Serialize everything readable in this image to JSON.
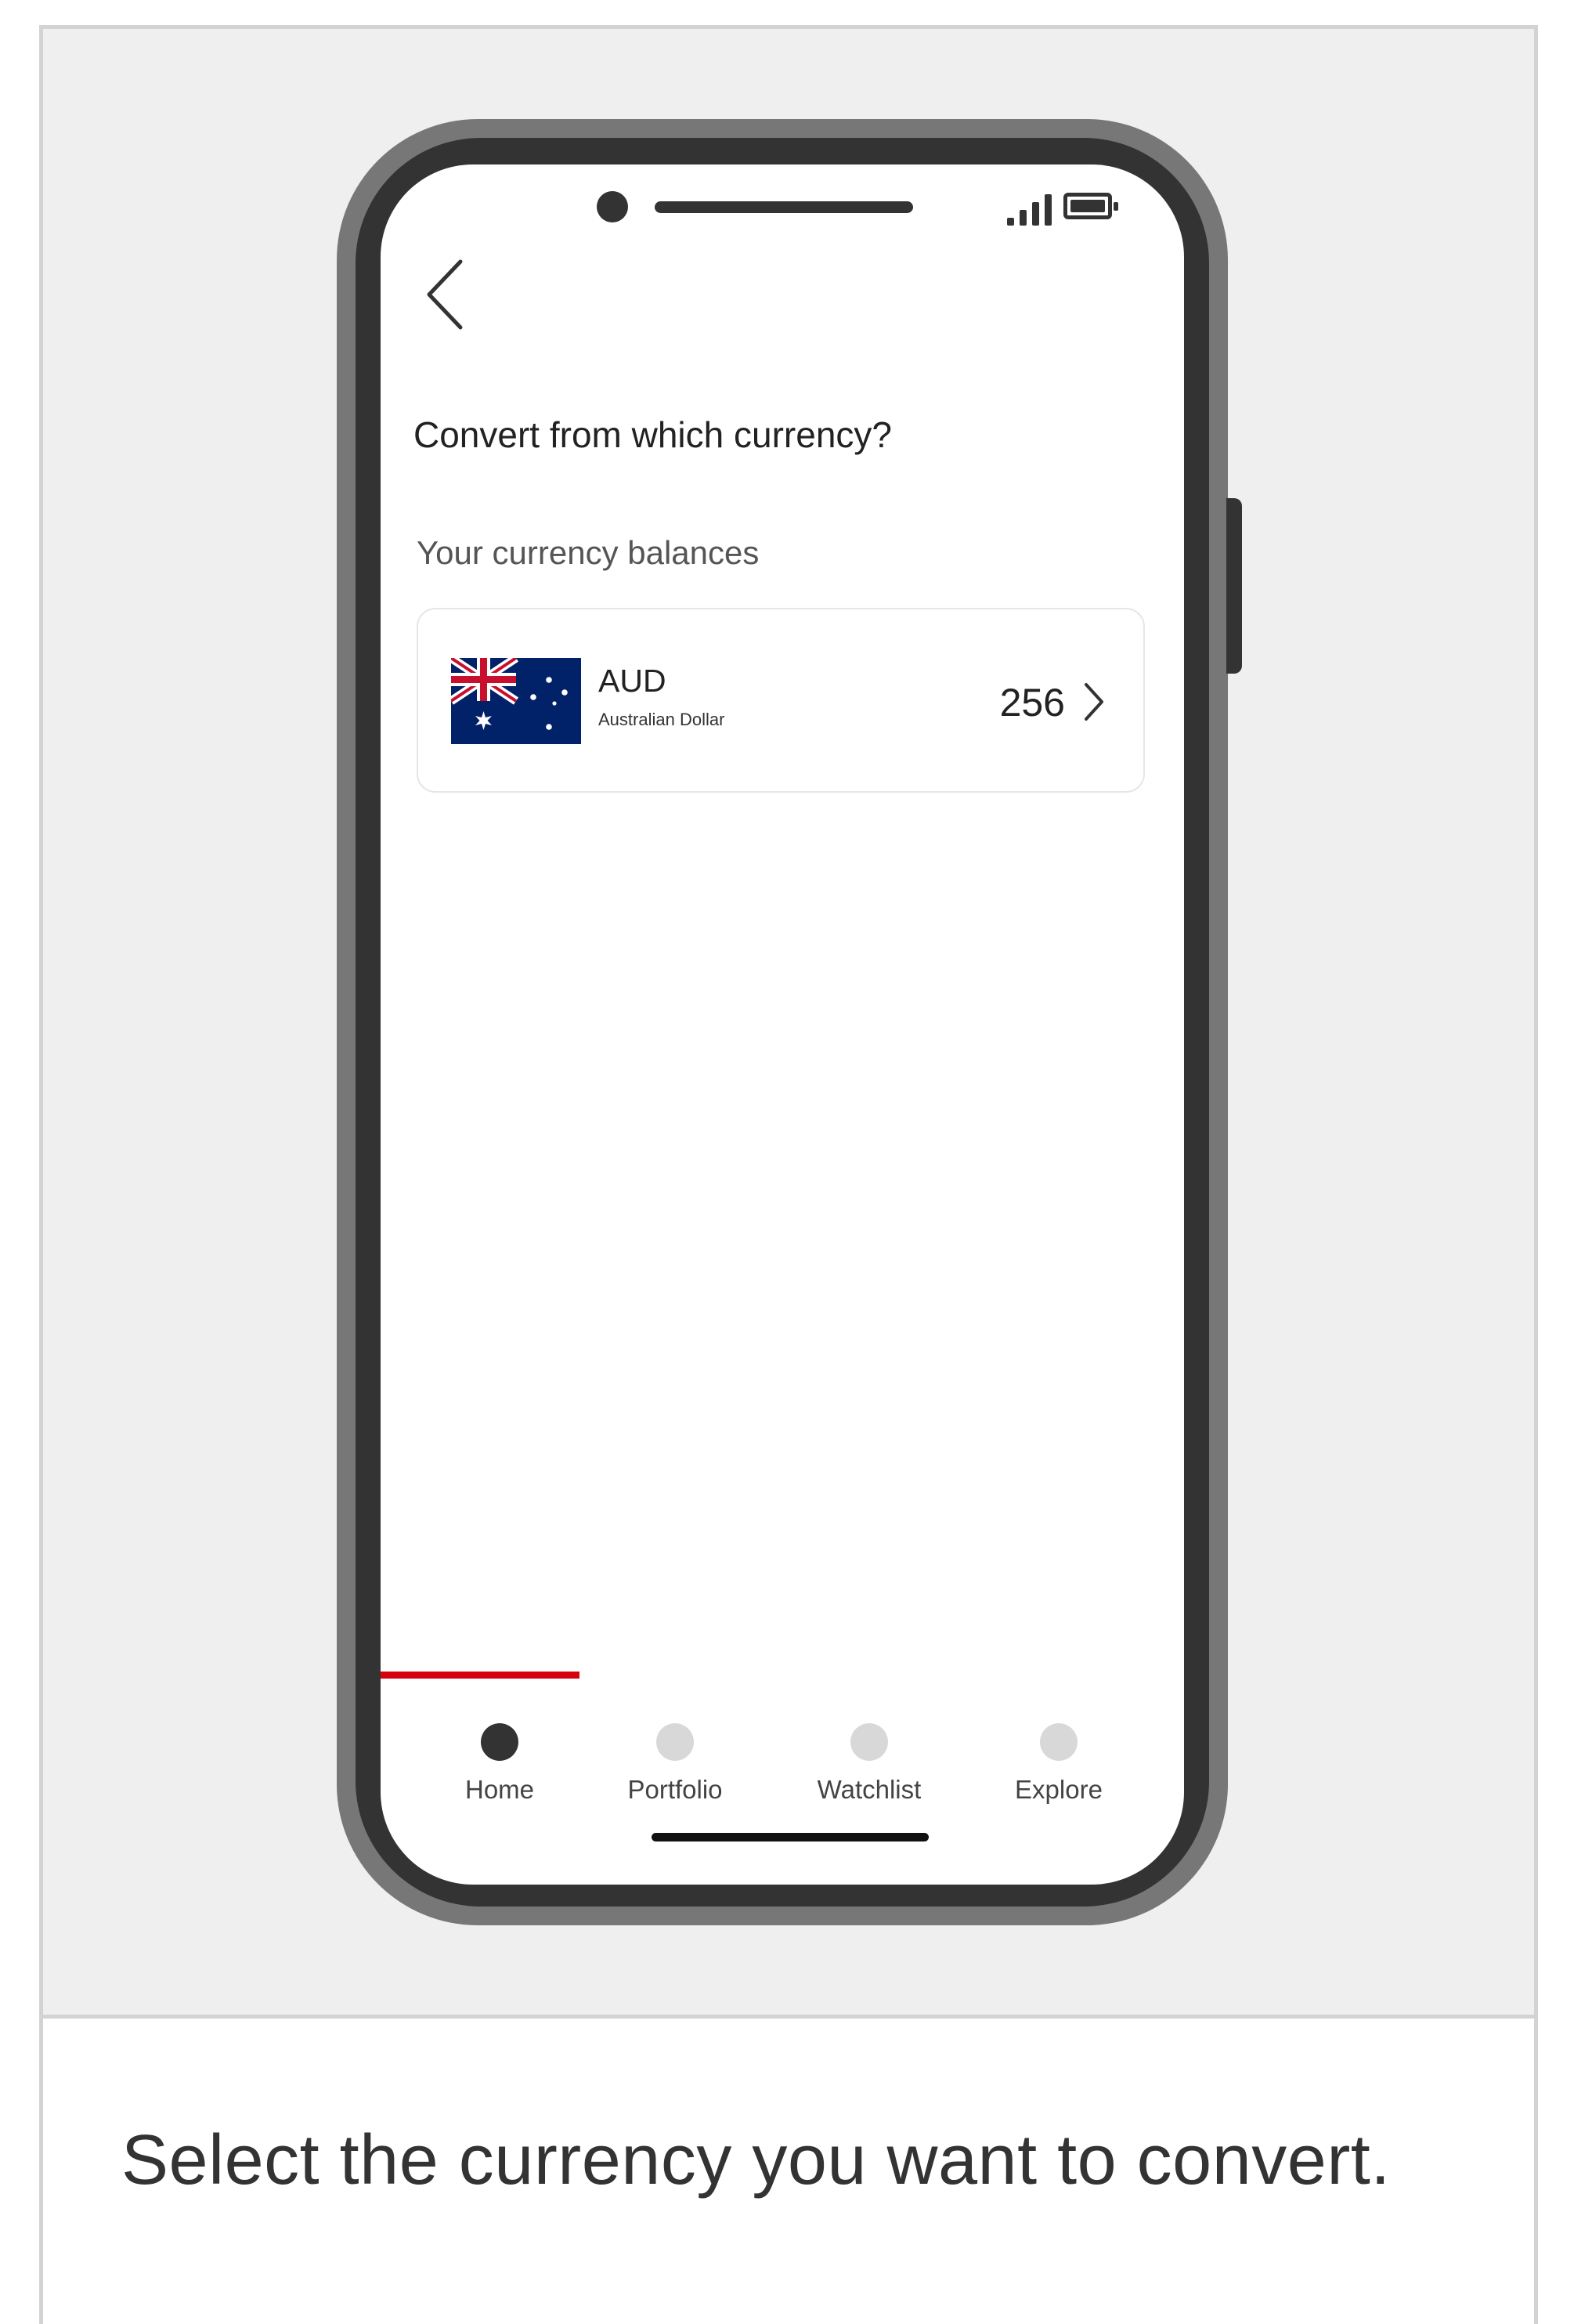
{
  "screen": {
    "title": "Convert from which currency?",
    "section_label": "Your currency balances",
    "back_icon": "chevron-left-icon"
  },
  "balances": [
    {
      "code": "AUD",
      "name": "Australian Dollar",
      "amount": "256",
      "flag": "australia-flag-icon"
    }
  ],
  "nav": {
    "items": [
      {
        "label": "Home",
        "active": true
      },
      {
        "label": "Portfolio",
        "active": false
      },
      {
        "label": "Watchlist",
        "active": false
      },
      {
        "label": "Explore",
        "active": false
      }
    ],
    "active_color": "#d7000f"
  },
  "caption": "Select the currency you want to convert.",
  "colors": {
    "accent": "#d7000f",
    "phone_frame": "#333333",
    "background": "#efefef"
  }
}
